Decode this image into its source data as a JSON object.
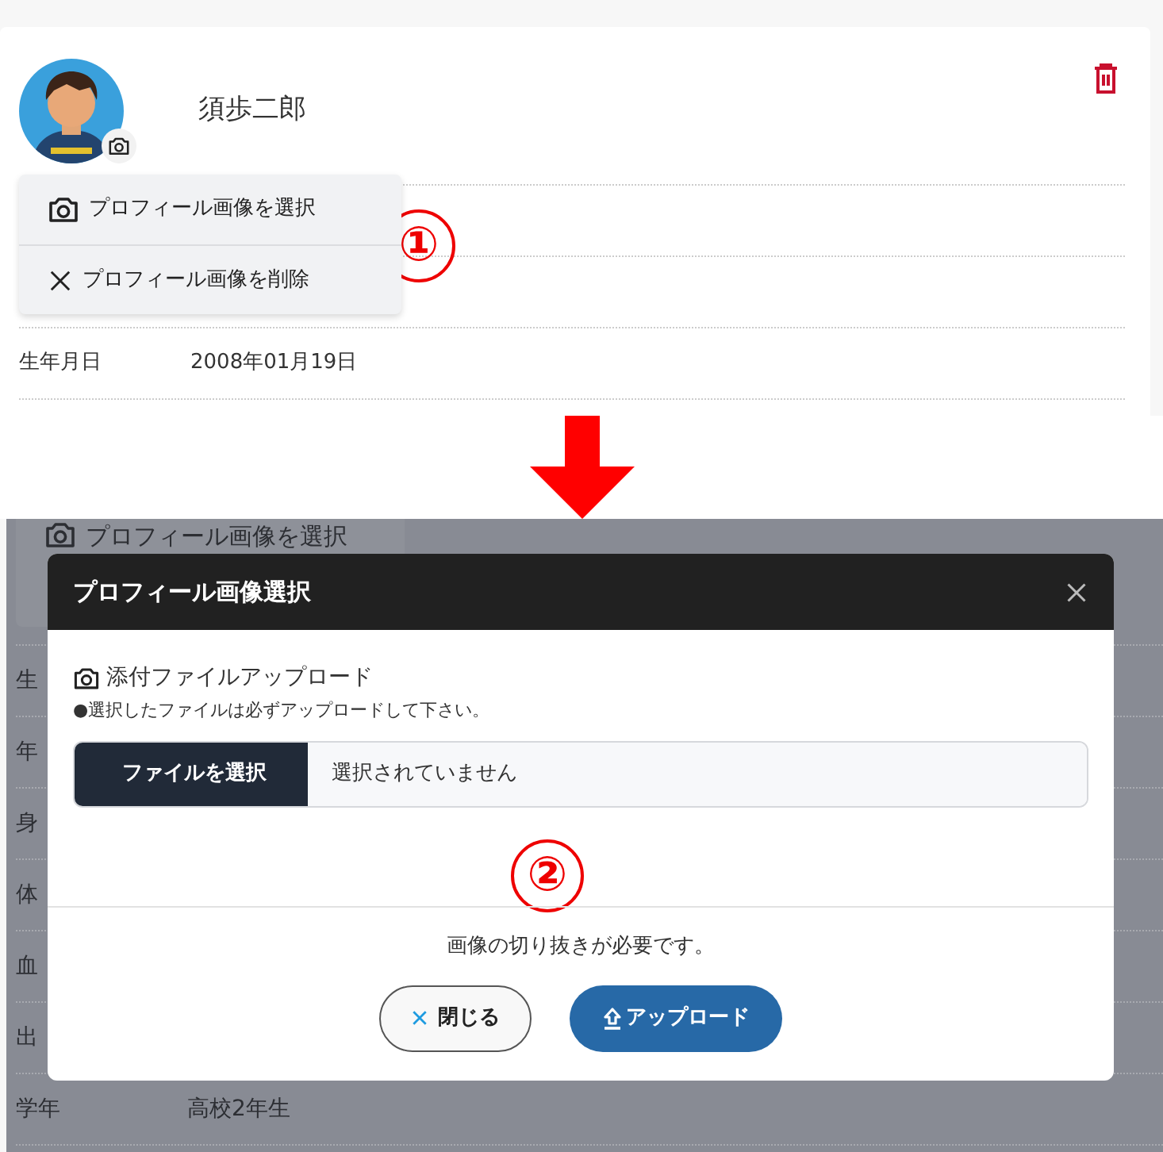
{
  "profile": {
    "name": "須歩二郎"
  },
  "avatar_menu": [
    {
      "kind": "select",
      "label": "プロフィール画像を選択"
    },
    {
      "kind": "remove",
      "label": "プロフィール画像を削除"
    }
  ],
  "rows": [
    {
      "label": "生年月日",
      "value": "2008年01月19日"
    }
  ],
  "step_marks": [
    "①",
    "②"
  ],
  "dimmed_page": {
    "menu_item": "プロフィール画像を選択",
    "rows": [
      {
        "label": "生"
      },
      {
        "label": "年"
      },
      {
        "label": "身"
      },
      {
        "label": "体"
      },
      {
        "label": "血"
      },
      {
        "label": "出"
      },
      {
        "label": "学年",
        "value": "高校2年生"
      }
    ]
  },
  "modal": {
    "title": "プロフィール画像選択",
    "section_label": "添付ファイルアップロード",
    "note": "●選択したファイルは必ずアップロードして下さい。",
    "file_button": "ファイルを選択",
    "file_status": "選択されていません",
    "footer_note": "画像の切り抜きが必要です。",
    "buttons": [
      {
        "kind": "close",
        "label": "閉じる"
      },
      {
        "kind": "upload",
        "label": "アップロード"
      }
    ]
  }
}
